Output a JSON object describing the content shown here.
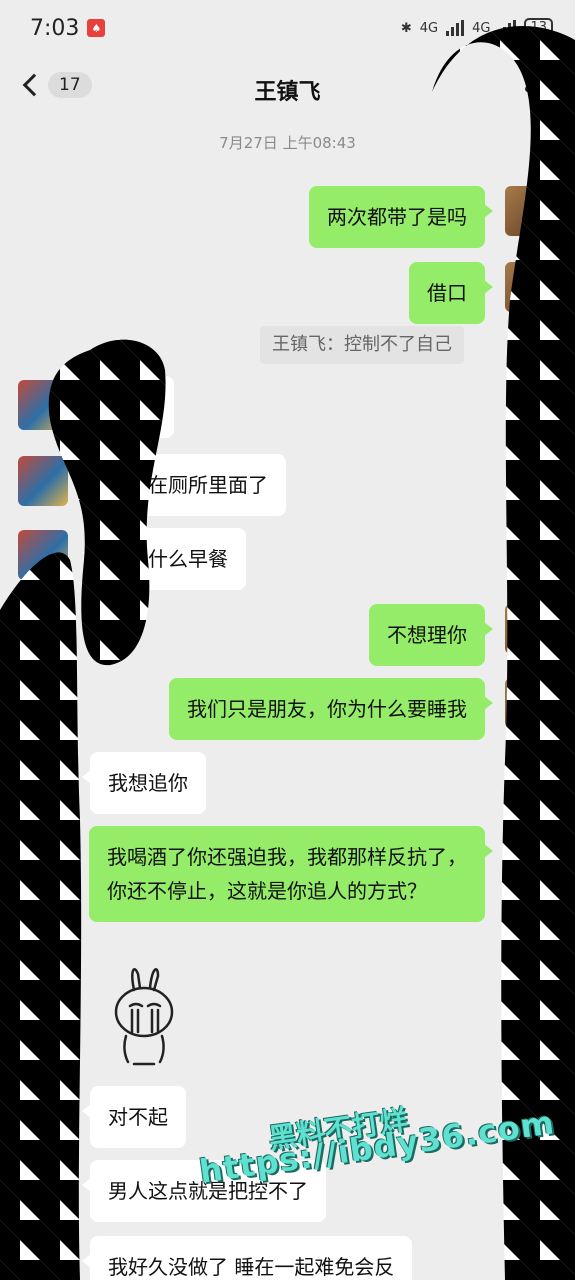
{
  "status_bar": {
    "time": "7:03",
    "notif_glyph": "♠",
    "network_1": "4G",
    "network_2": "4G",
    "battery": "13",
    "icons": [
      "bluetooth-icon",
      "signal-icon",
      "battery-icon"
    ]
  },
  "nav": {
    "back_count": "17",
    "title": "王镇飞"
  },
  "timestamp": "7月27日 上午08:43",
  "messages": [
    {
      "side": "out",
      "text": "两次都带了是吗"
    },
    {
      "side": "out",
      "text": "借口"
    },
    {
      "side": "system",
      "text": "王镇飞：控制不了自己"
    },
    {
      "side": "in",
      "text": ""
    },
    {
      "side": "in",
      "text": "都丢在厕所里面了"
    },
    {
      "side": "in",
      "text": "吃点什么早餐"
    },
    {
      "side": "out",
      "text": "不想理你"
    },
    {
      "side": "out",
      "text": "我们只是朋友，你为什么要睡我"
    },
    {
      "side": "in",
      "text": "我想追你"
    },
    {
      "side": "out",
      "text": "我喝酒了你还强迫我，我都那样反抗了，你还不停止，这就是你追人的方式？"
    },
    {
      "side": "in",
      "type": "sticker",
      "text": ""
    },
    {
      "side": "in",
      "text": "对不起"
    },
    {
      "side": "in",
      "text": "男人这点就是把控不了"
    },
    {
      "side": "in",
      "text": "我好久没做了 睡在一起难免会反"
    }
  ],
  "watermark": {
    "line1": "黑料不打烊",
    "line2": "https://ibdy36.com"
  },
  "colors": {
    "background": "#ededed",
    "outgoing_bubble": "#95ec69",
    "incoming_bubble": "#ffffff"
  }
}
